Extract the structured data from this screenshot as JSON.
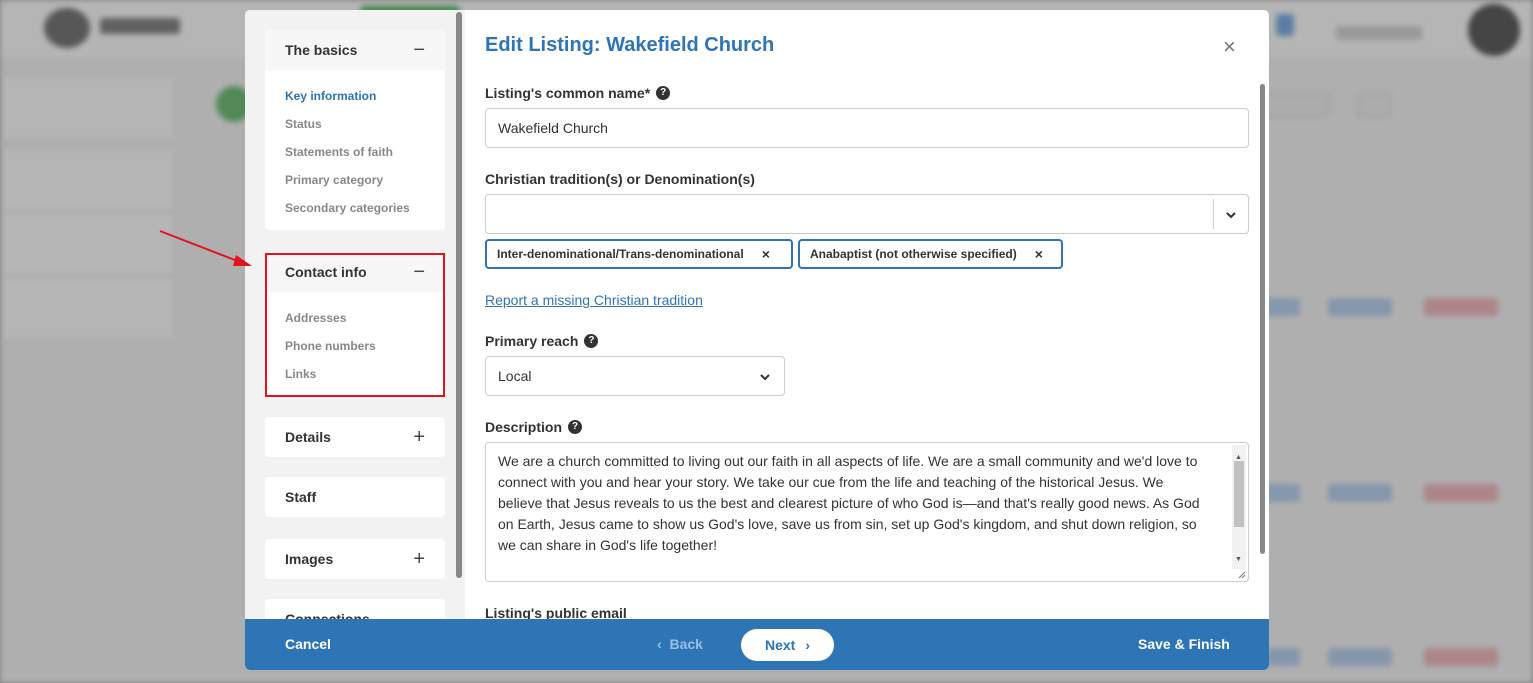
{
  "modal": {
    "title": "Edit Listing: Wakefield Church",
    "close_icon": "close-icon"
  },
  "sidebar": {
    "sections": [
      {
        "label": "The basics",
        "toggle": "−",
        "items": [
          "Key information",
          "Status",
          "Statements of faith",
          "Primary category",
          "Secondary categories"
        ]
      },
      {
        "label": "Contact info",
        "toggle": "−",
        "items": [
          "Addresses",
          "Phone numbers",
          "Links"
        ]
      },
      {
        "label": "Details",
        "toggle": "+"
      },
      {
        "label": "Staff"
      },
      {
        "label": "Images",
        "toggle": "+"
      },
      {
        "label": "Connections"
      }
    ]
  },
  "form": {
    "common_name_label": "Listing's common name*",
    "common_name_value": "Wakefield Church",
    "tradition_label": "Christian tradition(s) or Denomination(s)",
    "tradition_tags": [
      "Inter-denominational/Trans-denominational",
      "Anabaptist (not otherwise specified)"
    ],
    "report_link": "Report a missing Christian tradition",
    "primary_reach_label": "Primary reach",
    "primary_reach_value": "Local",
    "description_label": "Description",
    "description_value": "We are a church committed to living out our faith in all aspects of life. We are a small community and we'd love to connect with you and hear your story.  We take our cue from the life and teaching of the historical Jesus. We believe that Jesus reveals to us the best and clearest picture of who God is—and that's really good news. As God on Earth, Jesus came to show us God's love, save us from sin, set up God's kingdom, and shut down religion, so we can share in God's life together!",
    "public_email_label": "Listing's public email",
    "help_glyph": "?"
  },
  "footer": {
    "cancel": "Cancel",
    "back": "Back",
    "next": "Next",
    "save": "Save & Finish"
  },
  "colors": {
    "accent": "#2e75b6",
    "highlight": "#e3121f"
  }
}
